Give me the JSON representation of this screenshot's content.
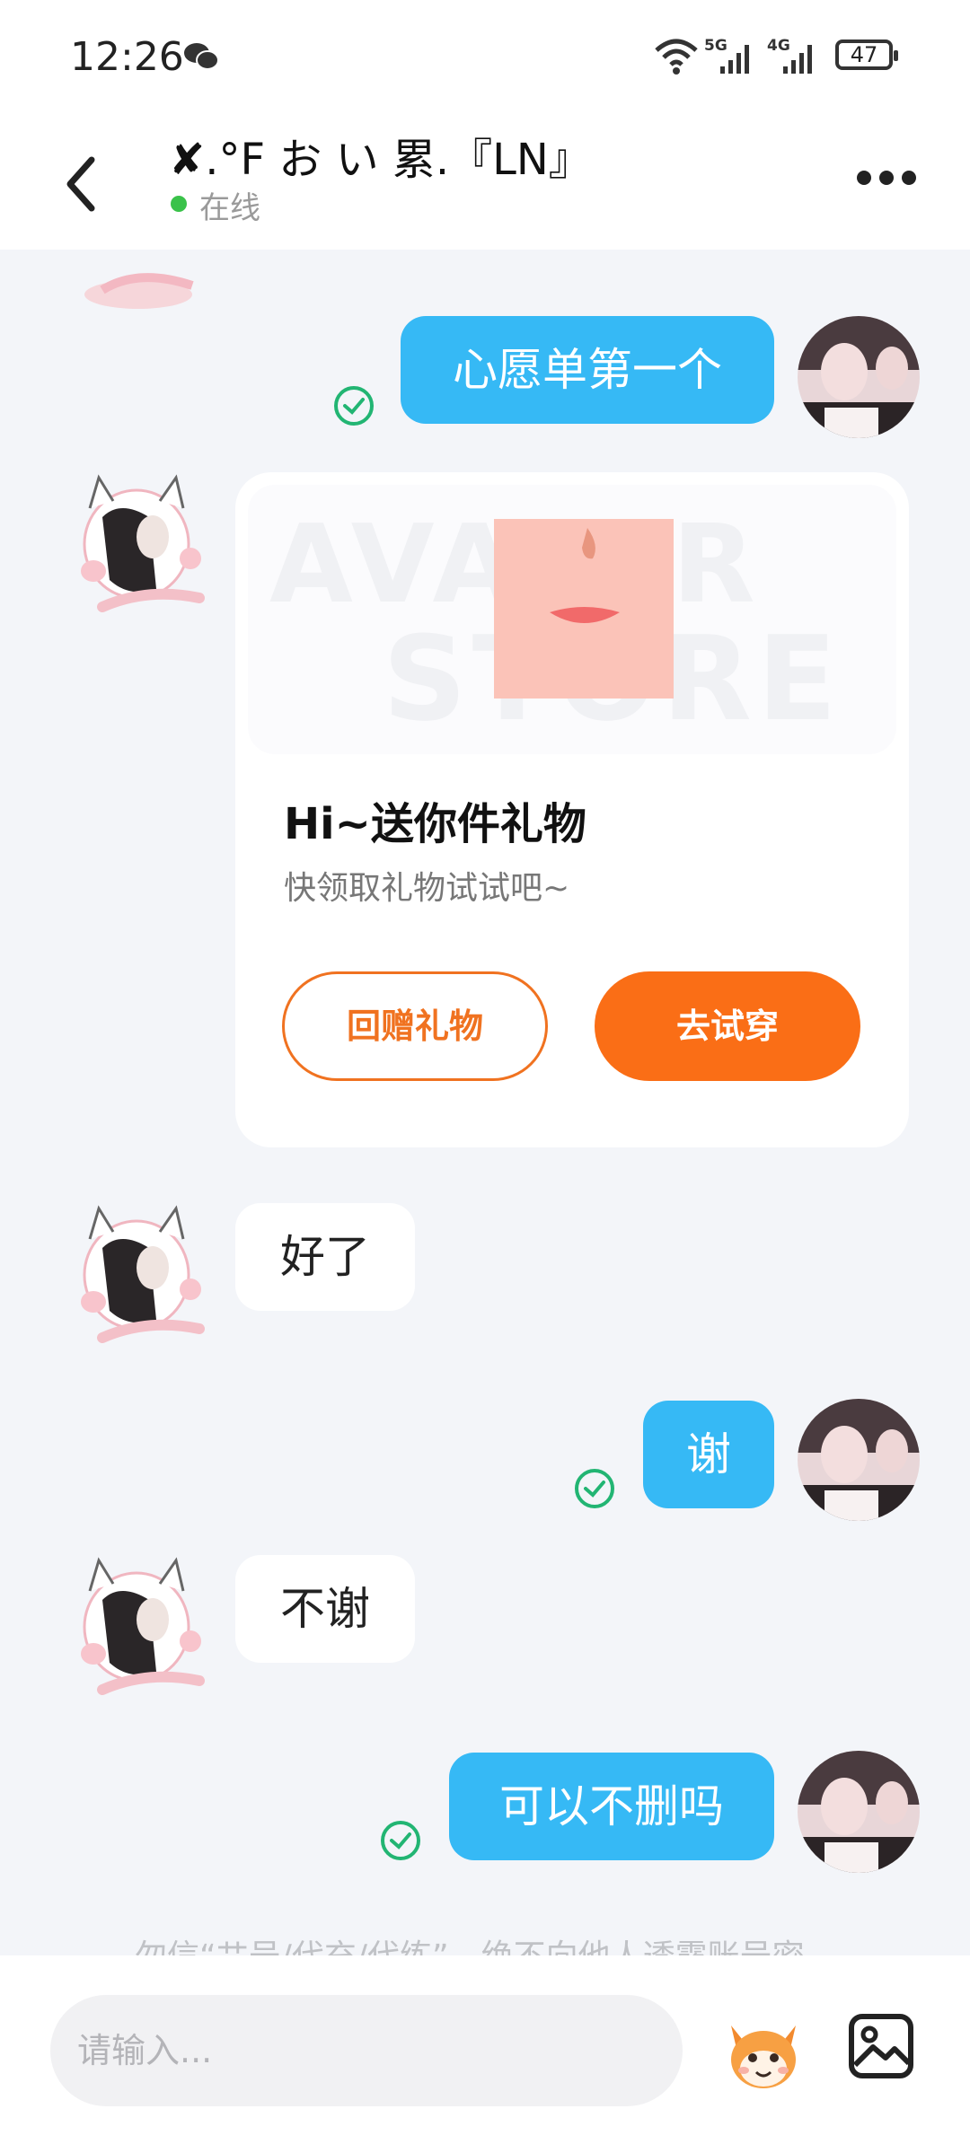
{
  "status_bar": {
    "time": "12:26",
    "net_a": "5G",
    "net_b": "4G",
    "battery": "47"
  },
  "header": {
    "title": "✘.°F お い 累.『LN』",
    "status": "在线"
  },
  "messages": [
    {
      "side": "me",
      "text": "心愿单第一个"
    },
    {
      "side": "peer",
      "type": "gift_card",
      "watermark_a": "AVATAR",
      "watermark_b": "STORE",
      "title": "Hi~送你件礼物",
      "subtitle": "快领取礼物试试吧~",
      "btn_return": "回赠礼物",
      "btn_try": "去试穿"
    },
    {
      "side": "peer",
      "text": "好了"
    },
    {
      "side": "me",
      "text": "谢"
    },
    {
      "side": "peer",
      "text": "不谢"
    },
    {
      "side": "me",
      "text": "可以不删吗"
    }
  ],
  "notice": "勿信“艹号/代充/代练”，绝不向他人透露账号密...",
  "composer": {
    "placeholder": "请输入..."
  },
  "colors": {
    "bubble_me": "#36b9f5",
    "accent_orange": "#fa6e16",
    "online": "#3ac24a"
  }
}
